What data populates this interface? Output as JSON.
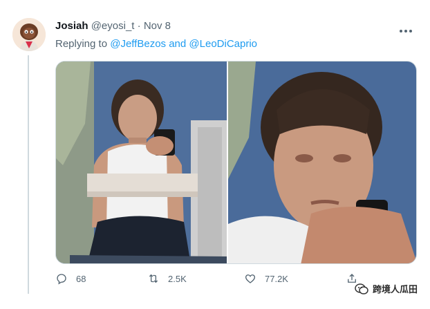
{
  "tweet": {
    "author_name": "Josiah",
    "author_handle": "@eyosi_t",
    "separator": " · ",
    "date": "Nov 8",
    "replying_prefix": "Replying to ",
    "mention_1": "@JeffBezos",
    "mention_joiner": " and ",
    "mention_2": "@LeoDiCaprio"
  },
  "actions": {
    "reply_count": "68",
    "retweet_count": "2.5K",
    "like_count": "77.2K"
  },
  "watermark": {
    "text": "跨境人瓜田"
  },
  "icons": {
    "avatar": "avatar-illustration",
    "more": "more-icon",
    "reply": "reply-icon",
    "retweet": "retweet-icon",
    "like": "like-icon",
    "share": "share-icon"
  },
  "colors": {
    "link": "#1d9bf0",
    "meta": "#536471",
    "thread_line": "#cfd9de"
  }
}
